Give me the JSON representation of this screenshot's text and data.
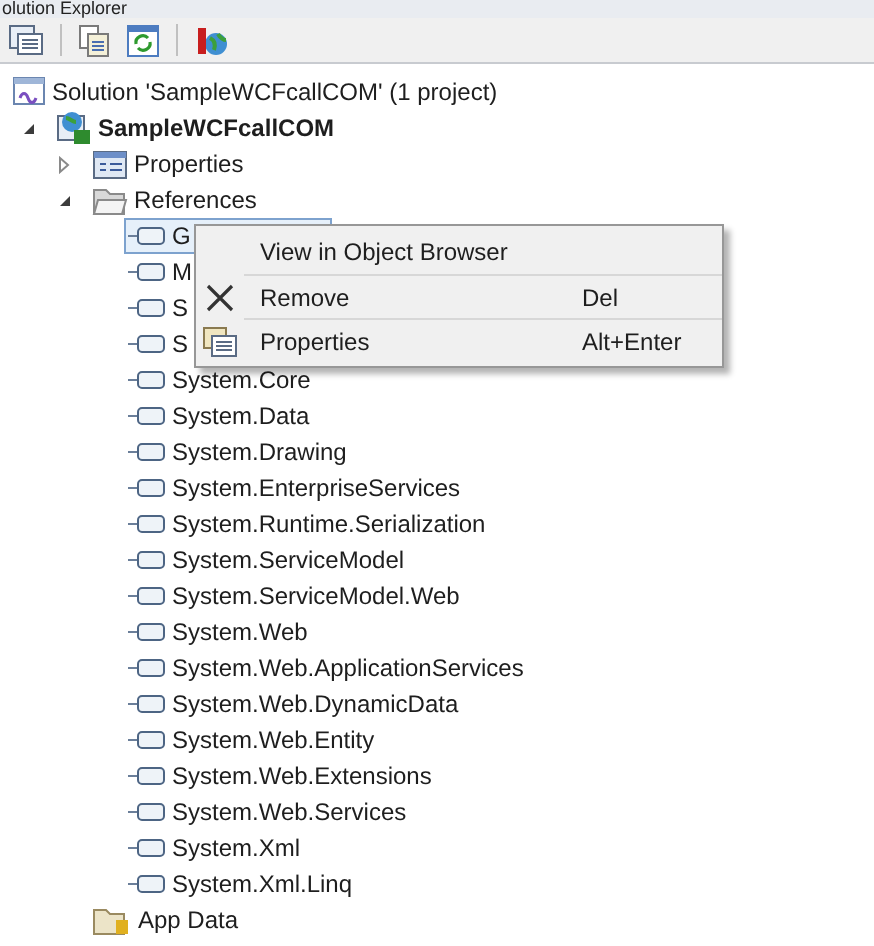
{
  "window": {
    "title": "olution Explorer"
  },
  "toolbar": [
    {
      "kind": "properties"
    },
    {
      "kind": "show-all"
    },
    {
      "kind": "refresh"
    },
    {
      "kind": "wcf"
    }
  ],
  "tree": [
    {
      "label": "Solution 'SampleWCFcallCOM' (1 project)",
      "kind": "solution",
      "bold": false,
      "children": [
        {
          "label": "SampleWCFcallCOM",
          "kind": "project",
          "bold": true,
          "expanded": true,
          "children": [
            {
              "label": "Properties",
              "kind": "properties",
              "expanded": false
            },
            {
              "label": "References",
              "kind": "folder",
              "expanded": true,
              "children": [
                {
                  "label": "G",
                  "kind": "reference",
                  "selected": true
                },
                {
                  "label": "M",
                  "kind": "reference",
                  "selected": false
                },
                {
                  "label": "S",
                  "kind": "reference",
                  "selected": false
                },
                {
                  "label": "S",
                  "kind": "reference",
                  "selected": false
                },
                {
                  "label": "System.Core",
                  "kind": "reference",
                  "selected": false
                },
                {
                  "label": "System.Data",
                  "kind": "reference",
                  "selected": false
                },
                {
                  "label": "System.Drawing",
                  "kind": "reference",
                  "selected": false
                },
                {
                  "label": "System.EnterpriseServices",
                  "kind": "reference",
                  "selected": false
                },
                {
                  "label": "System.Runtime.Serialization",
                  "kind": "reference",
                  "selected": false
                },
                {
                  "label": "System.ServiceModel",
                  "kind": "reference",
                  "selected": false
                },
                {
                  "label": "System.ServiceModel.Web",
                  "kind": "reference",
                  "selected": false
                },
                {
                  "label": "System.Web",
                  "kind": "reference",
                  "selected": false
                },
                {
                  "label": "System.Web.ApplicationServices",
                  "kind": "reference",
                  "selected": false
                },
                {
                  "label": "System.Web.DynamicData",
                  "kind": "reference",
                  "selected": false
                },
                {
                  "label": "System.Web.Entity",
                  "kind": "reference",
                  "selected": false
                },
                {
                  "label": "System.Web.Extensions",
                  "kind": "reference",
                  "selected": false
                },
                {
                  "label": "System.Web.Services",
                  "kind": "reference",
                  "selected": false
                },
                {
                  "label": "System.Xml",
                  "kind": "reference",
                  "selected": false
                },
                {
                  "label": "System.Xml.Linq",
                  "kind": "reference",
                  "selected": false
                }
              ]
            },
            {
              "label": "App Data",
              "kind": "data-folder"
            }
          ]
        }
      ]
    }
  ],
  "context_menu": {
    "items": [
      {
        "label": "View in Object Browser",
        "kind": "plain"
      },
      {
        "label": "Remove",
        "shortcut": "Del",
        "kind": "remove"
      },
      {
        "label": "Properties",
        "shortcut": "Alt+Enter",
        "kind": "properties"
      }
    ]
  }
}
